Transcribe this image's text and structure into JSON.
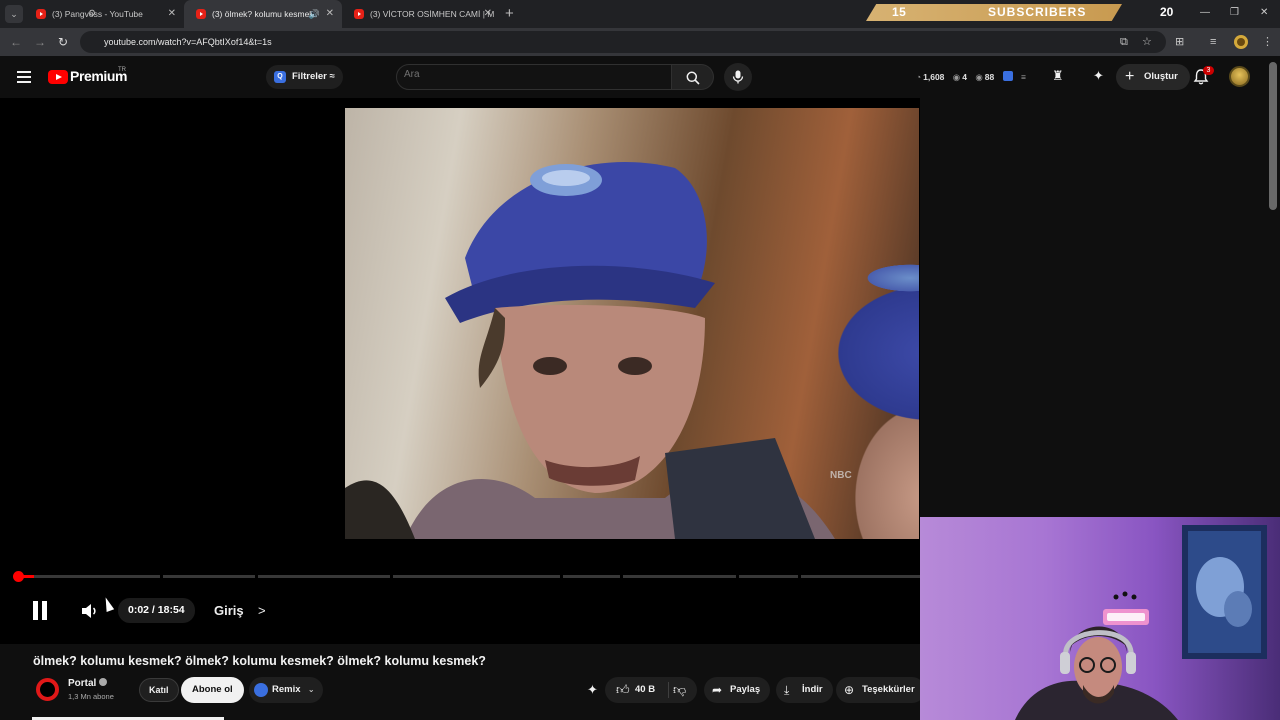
{
  "browser": {
    "tabs": [
      {
        "label": "(3) Pangvoss - YouTube"
      },
      {
        "label": "(3) ölmek? kolumu kesmek"
      },
      {
        "label": "(3) VİCTOR OSİMHEN CAMİ | M"
      }
    ],
    "url": "youtube.com/watch?v=AFQbtIXof14&t=1s",
    "subscriber_goal": {
      "current": "15",
      "label": "SUBSCRIBERS",
      "target": "20"
    }
  },
  "masthead": {
    "logo": "Premium",
    "region": "TR",
    "filters_label": "Filtreler",
    "search_placeholder": "Ara",
    "stats": {
      "a": "1,608",
      "b": "4",
      "c": "88"
    },
    "create_label": "Oluştur",
    "notifications": "3"
  },
  "player": {
    "time": "0:02 / 18:54",
    "chapter": "Giriş",
    "chapter_arrow": ">",
    "watermark": "NBC",
    "progress_fraction": 0.0018
  },
  "video": {
    "title": "ölmek? kolumu kesmek? ölmek? kolumu kesmek? ölmek? kolumu kesmek?",
    "channel": "Portal",
    "subscribers": "1,3 Mn abone",
    "join_label": "Katıl",
    "subscribe_label": "Abone ol",
    "remix_label": "Remix",
    "likes": "40 B",
    "share_label": "Paylaş",
    "download_label": "İndir",
    "thanks_label": "Teşekkürler"
  },
  "colors": {
    "accent": "#ff0000",
    "background": "#0f0f0f",
    "gold": "#c89a50"
  }
}
